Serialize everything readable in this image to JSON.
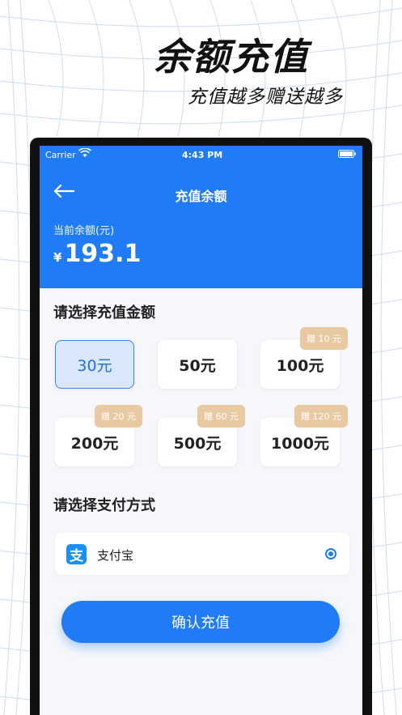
{
  "headline": {
    "title": "余额充值",
    "subtitle": "充值越多赠送越多"
  },
  "status_bar": {
    "carrier": "Carrier",
    "time": "4:43 PM"
  },
  "nav": {
    "title": "充值余额"
  },
  "balance": {
    "label": "当前余额(元)",
    "currency": "¥",
    "amount": "193.1"
  },
  "amount_section": {
    "title": "请选择充值金额",
    "options": [
      {
        "label": "30元",
        "bonus": "",
        "selected": true
      },
      {
        "label": "50元",
        "bonus": "",
        "selected": false
      },
      {
        "label": "100元",
        "bonus": "赠 10 元",
        "selected": false
      },
      {
        "label": "200元",
        "bonus": "赠 20 元",
        "selected": false
      },
      {
        "label": "500元",
        "bonus": "赠 60 元",
        "selected": false
      },
      {
        "label": "1000元",
        "bonus": "赠 120 元",
        "selected": false
      }
    ]
  },
  "payment_section": {
    "title": "请选择支付方式",
    "method": {
      "icon_text": "支",
      "label": "支付宝",
      "selected": true
    }
  },
  "confirm_label": "确认充值",
  "colors": {
    "primary": "#1f7cf6",
    "selected_bg": "#dbe8fb",
    "badge": "#e8c9a2"
  },
  "icons": [
    "wifi-icon",
    "battery-icon",
    "back-arrow-icon",
    "alipay-icon",
    "radio-selected-icon"
  ]
}
